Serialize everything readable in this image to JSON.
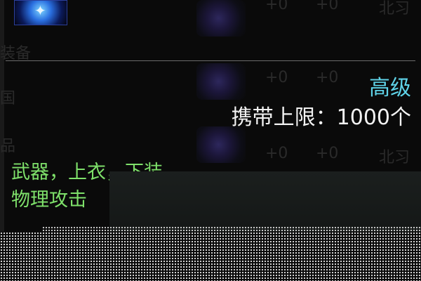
{
  "item": {
    "grade": "高级",
    "capacity_label": "携带上限：",
    "capacity_value": "1000个",
    "applicable_slots": "武器，上衣，下装",
    "attribute": "物理攻击"
  },
  "background_ghosts": [
    {
      "text": "+0"
    },
    {
      "text": "+0"
    },
    {
      "text": "北习"
    },
    {
      "text": "装备"
    },
    {
      "text": "+0"
    },
    {
      "text": "+0"
    },
    {
      "text": "国"
    },
    {
      "text": "品"
    },
    {
      "text": "+0"
    },
    {
      "text": "+0"
    },
    {
      "text": "北习"
    }
  ],
  "colors": {
    "grade": "#5fd3e8",
    "capacity": "#f2f2f2",
    "description": "#7ee06a",
    "divider": "#6b6b6b"
  },
  "icons": {
    "item_icon": "gem-orb-icon"
  }
}
